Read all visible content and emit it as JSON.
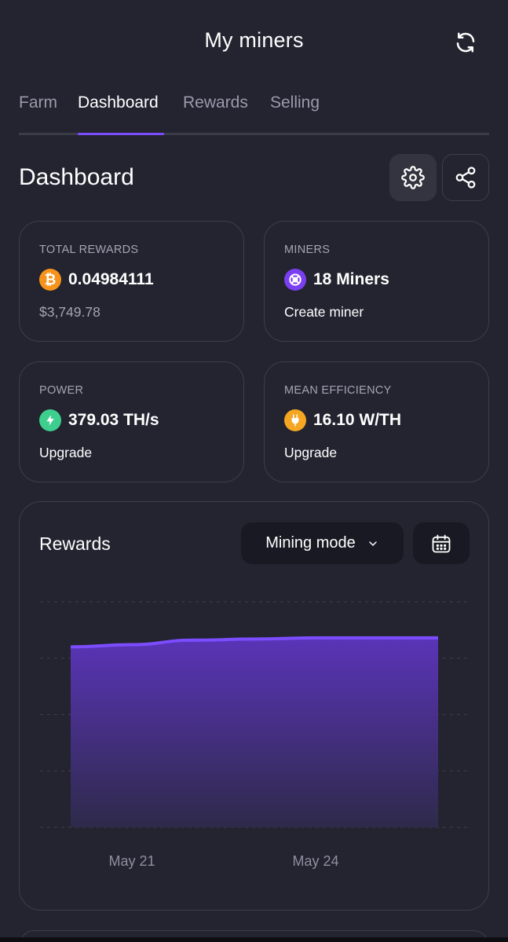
{
  "header": {
    "title": "My miners",
    "refresh_icon": "refresh-icon"
  },
  "tabs": [
    {
      "label": "Farm",
      "active": false
    },
    {
      "label": "Dashboard",
      "active": true
    },
    {
      "label": "Rewards",
      "active": false
    },
    {
      "label": "Selling",
      "active": false
    }
  ],
  "section": {
    "title": "Dashboard",
    "settings_icon": "gear-icon",
    "share_icon": "share-icon"
  },
  "cards": {
    "total_rewards": {
      "label": "TOTAL REWARDS",
      "value": "0.04984111",
      "sub": "$3,749.78",
      "icon": "bitcoin-icon"
    },
    "miners": {
      "label": "MINERS",
      "value": "18 Miners",
      "sub": "Create miner",
      "icon": "miner-icon"
    },
    "power": {
      "label": "POWER",
      "value": "379.03 TH/s",
      "sub": "Upgrade",
      "icon": "bolt-icon"
    },
    "efficiency": {
      "label": "MEAN EFFICIENCY",
      "value": "16.10 W/TH",
      "sub": "Upgrade",
      "icon": "plug-icon"
    }
  },
  "rewards_chart": {
    "title": "Rewards",
    "mode_label": "Mining mode",
    "calendar_icon": "calendar-icon"
  },
  "colors": {
    "background": "#232430",
    "accent": "#7c4dff",
    "bitcoin": "#f7931a",
    "power": "#3ecf8e",
    "efficiency": "#f5a623"
  },
  "chart_data": {
    "type": "area",
    "x_tick_labels": [
      "May 21",
      "May 24"
    ],
    "x": [
      0,
      1,
      2,
      3,
      4,
      5,
      6
    ],
    "series": [
      {
        "values": [
          0.8,
          0.81,
          0.83,
          0.835,
          0.84,
          0.84,
          0.84
        ]
      }
    ],
    "ylim": [
      0,
      1
    ],
    "grid": true,
    "legend": "none"
  }
}
